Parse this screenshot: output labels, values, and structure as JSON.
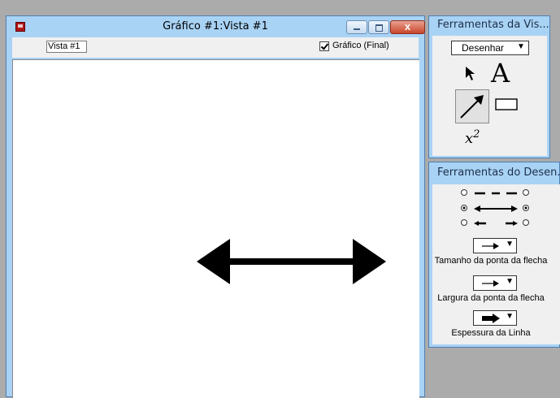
{
  "main_window": {
    "title": "Gráfico #1:Vista #1",
    "close_glyph": "x",
    "view_field_value": "Vista #1",
    "graph_checkbox_label": "Gráfico (Final)",
    "graph_checkbox_checked": true
  },
  "view_tools_panel": {
    "title": "Ferramentas da Vis...",
    "mode_select_value": "Desenhar",
    "mode_select_arrow": "▼",
    "text_tool_glyph": "A",
    "formula_base": "x",
    "formula_exp": "2",
    "active_tool": "arrow-line"
  },
  "drawing_tools_panel": {
    "title": "Ferramentas do Desen...",
    "line_styles": [
      {
        "name": "no-heads",
        "left_selected": false,
        "right_selected": false
      },
      {
        "name": "double-heads",
        "left_selected": true,
        "right_selected": true
      },
      {
        "name": "small-heads",
        "left_selected": false,
        "right_selected": false
      }
    ],
    "arrowhead_size_label": "Tamanho da ponta da flecha",
    "arrowhead_width_label": "Largura da ponta da flecha",
    "line_thickness_label": "Espessura da Linha",
    "dropdown_arrow": "▼"
  },
  "canvas": {
    "shapes": [
      {
        "type": "double-headed-arrow",
        "color": "#000000"
      }
    ]
  },
  "colors": {
    "window_frame": "#a9d3f5",
    "close_button": "#c9462c",
    "desktop": "#ababab"
  }
}
